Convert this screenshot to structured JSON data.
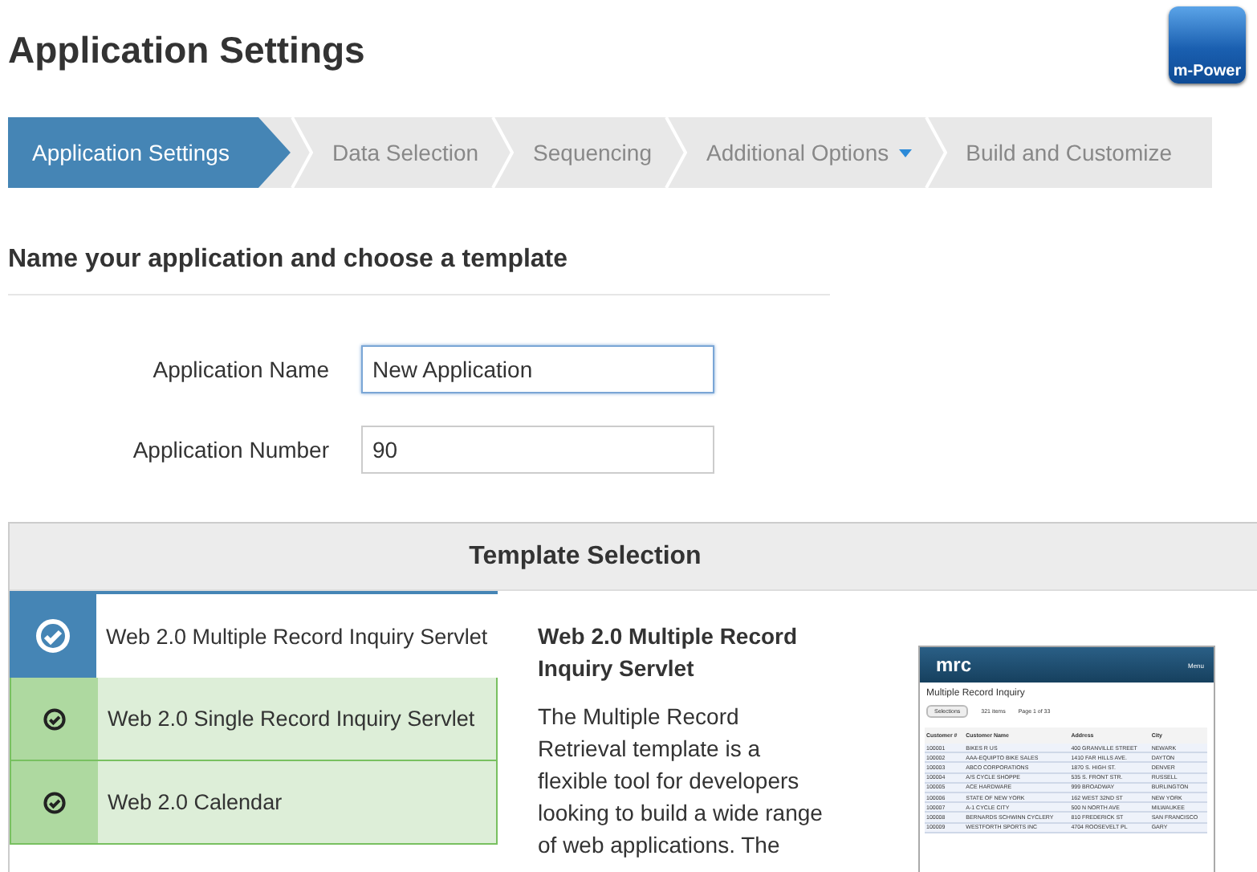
{
  "page_title": "Application Settings",
  "logo": {
    "text": "m-Power"
  },
  "steps": [
    {
      "label": "Application Settings",
      "selected": true,
      "dropdown": false
    },
    {
      "label": "Data Selection",
      "selected": false,
      "dropdown": false
    },
    {
      "label": "Sequencing",
      "selected": false,
      "dropdown": false
    },
    {
      "label": "Additional Options",
      "selected": false,
      "dropdown": true
    },
    {
      "label": "Build and Customize",
      "selected": false,
      "dropdown": false
    }
  ],
  "section_heading": "Name your application and choose a template",
  "fields": [
    {
      "label": "Application Name",
      "value": "New Application",
      "focused": true
    },
    {
      "label": "Application Number",
      "value": "90",
      "focused": false
    }
  ],
  "template_panel": {
    "title": "Template Selection",
    "templates": [
      {
        "label": "Web 2.0 Multiple Record Inquiry Servlet",
        "selected": true
      },
      {
        "label": "Web 2.0 Single Record Inquiry Servlet",
        "selected": false
      },
      {
        "label": "Web 2.0 Calendar",
        "selected": false
      }
    ],
    "description_title": "Web 2.0 Multiple Record Inquiry Servlet",
    "description": "The Multiple Record Retrieval template is a flexible tool for developers looking to build a wide range of web applications. The",
    "preview": {
      "brand": "mrc",
      "menu": "Menu",
      "title": "Multiple Record Inquiry",
      "selections": "Selections",
      "count": "321 items",
      "page": "Page 1 of 33",
      "columns": [
        "Customer #",
        "Customer Name",
        "Address",
        "City"
      ],
      "rows": [
        [
          "100001",
          "BIKES R US",
          "400 GRANVILLE STREET",
          "NEWARK"
        ],
        [
          "100002",
          "AAA-EQUIPTO BIKE SALES",
          "1410 FAR HILLS AVE.",
          "DAYTON"
        ],
        [
          "100003",
          "ABCO CORPORATIONS",
          "1870 S. HIGH ST.",
          "DENVER"
        ],
        [
          "100004",
          "A/S CYCLE SHOPPE",
          "535 S. FRONT STR.",
          "RUSSELL"
        ],
        [
          "100005",
          "ACE HARDWARE",
          "999 BROADWAY",
          "BURLINGTON"
        ],
        [
          "100006",
          "STATE OF NEW YORK",
          "162 WEST 32ND ST",
          "NEW YORK"
        ],
        [
          "100007",
          "A-1 CYCLE CITY",
          "500 N NORTH AVE",
          "MILWAUKEE"
        ],
        [
          "100008",
          "BERNARDS SCHWINN CYCLERY",
          "810 FREDERICK ST",
          "SAN FRANCISCO"
        ],
        [
          "100009",
          "WESTFORTH SPORTS INC",
          "4704 ROOSEVELT PL",
          "GARY"
        ]
      ]
    }
  }
}
